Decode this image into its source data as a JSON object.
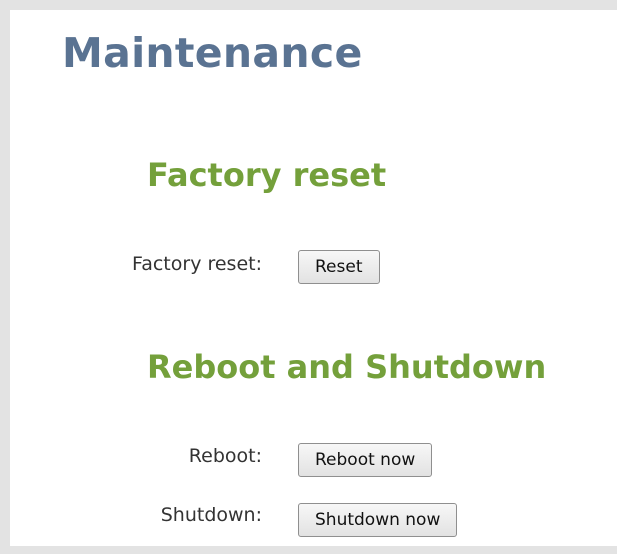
{
  "page": {
    "title": "Maintenance"
  },
  "factory_reset": {
    "heading": "Factory reset",
    "label": "Factory reset:",
    "button_label": "Reset"
  },
  "reboot_shutdown": {
    "heading": "Reboot and Shutdown",
    "reboot_label": "Reboot:",
    "reboot_button_label": "Reboot now",
    "shutdown_label": "Shutdown:",
    "shutdown_button_label": "Shutdown now"
  },
  "colors": {
    "title": "#5a7392",
    "section_heading": "#74a03b",
    "frame_border": "#e3e3e3"
  }
}
